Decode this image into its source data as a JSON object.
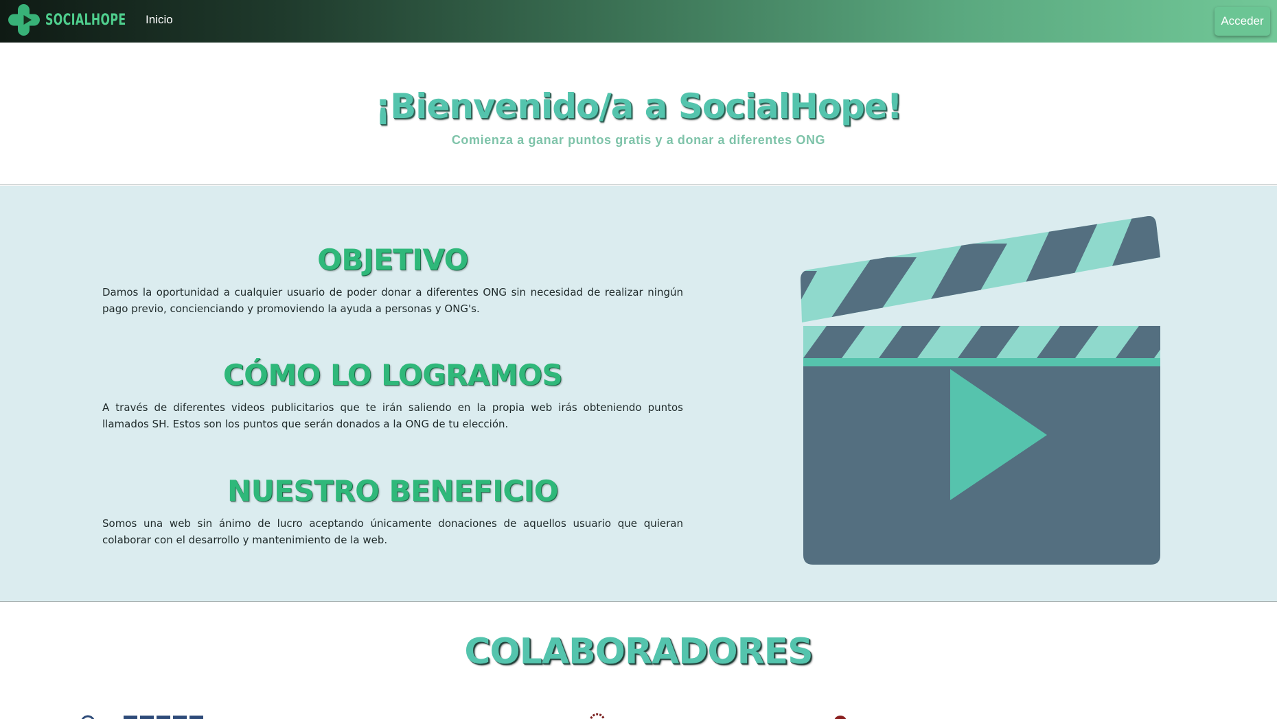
{
  "navbar": {
    "brand_name": "SOCIALHOPE",
    "logo_icon": "plus-leaf-icon",
    "links": [
      {
        "label": "Inicio"
      }
    ],
    "login_label": "Acceder"
  },
  "hero": {
    "title": "¡Bienvenido/a a SocialHope!",
    "subtitle": "Comienza a ganar puntos gratis y a donar a diferentes ONG"
  },
  "info": {
    "blocks": [
      {
        "title": "OBJETIVO",
        "text": "Damos la oportunidad a cualquier usuario de poder donar a diferentes ONG sin necesidad de realizar ningún pago previo, concienciando y promoviendo la ayuda a personas y ONG's."
      },
      {
        "title": "CÓMO LO LOGRAMOS",
        "text": "A través de diferentes videos publicitarios que te irán saliendo en la propia web irás obteniendo puntos llamados SH. Estos son los puntos que serán donados a la ONG de tu elección."
      },
      {
        "title": "NUESTRO BENEFICIO",
        "text": "Somos una web sin ánimo de lucro aceptando únicamente donaciones de aquellos usuario que quieran colaborar con el desarrollo y mantenimiento de la web."
      }
    ],
    "illustration_icon": "clapperboard-play-icon"
  },
  "collaborators": {
    "title": "COLABORADORES"
  },
  "colors": {
    "accent_teal": "#54c4ad",
    "accent_green": "#2fb87a",
    "section_bg": "#dbecef",
    "clapper_dark": "#546f80",
    "clapper_light": "#8fd9cc"
  }
}
